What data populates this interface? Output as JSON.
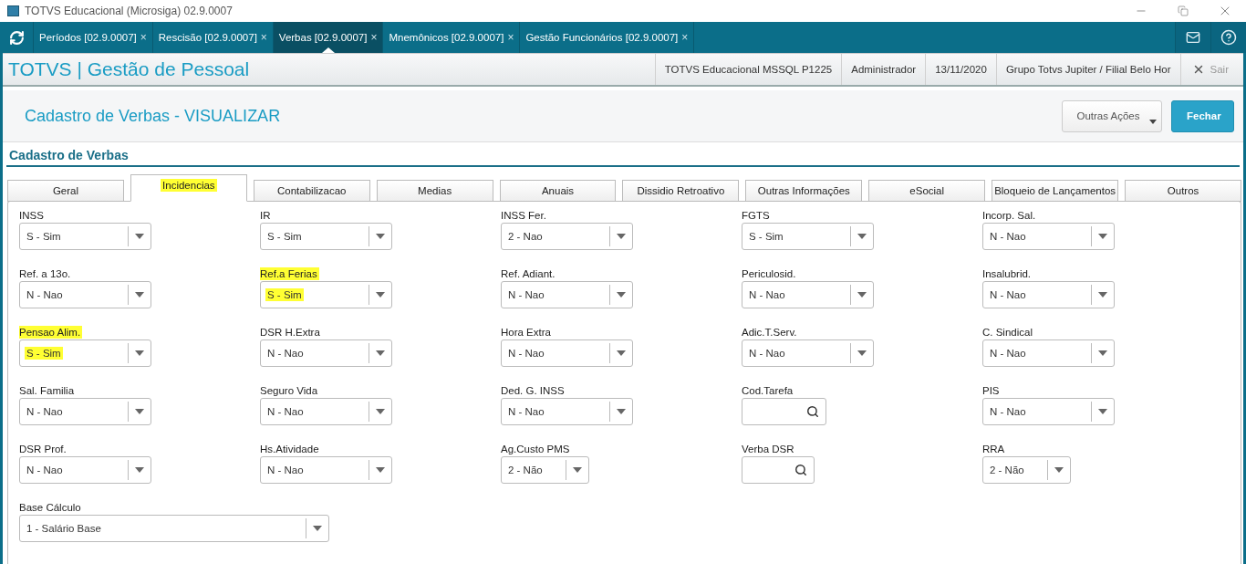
{
  "window": {
    "title": "TOTVS Educacional (Microsiga) 02.9.0007"
  },
  "app_tabs": [
    {
      "label": "Períodos [02.9.0007]",
      "close": "×",
      "selected": false
    },
    {
      "label": "Rescisão [02.9.0007]",
      "close": "×",
      "selected": false
    },
    {
      "label": "Verbas [02.9.0007]",
      "close": "×",
      "selected": true
    },
    {
      "label": "Mnemônicos [02.9.0007]",
      "close": "×",
      "selected": false
    },
    {
      "label": "Gestão Funcionários [02.9.0007]",
      "close": "×",
      "selected": false
    }
  ],
  "header": {
    "brand": "TOTVS | Gestão de Pessoal",
    "info": [
      "TOTVS Educacional MSSQL P1225",
      "Administrador",
      "13/11/2020",
      "Grupo Totvs Jupiter / Filial Belo Hor"
    ],
    "exit": "Sair"
  },
  "page": {
    "title": "Cadastro de Verbas - VISUALIZAR",
    "actions": [
      {
        "label": "Outras Ações",
        "kind": "menu"
      },
      {
        "label": "Fechar",
        "kind": "primary"
      }
    ]
  },
  "section": {
    "title": "Cadastro de Verbas"
  },
  "tabs": [
    {
      "label": "Geral",
      "selected": false,
      "highlighted": false
    },
    {
      "label": "Incidencias",
      "selected": true,
      "highlighted": true
    },
    {
      "label": "Contabilizacao",
      "selected": false,
      "highlighted": false
    },
    {
      "label": "Medias",
      "selected": false,
      "highlighted": false
    },
    {
      "label": "Anuais",
      "selected": false,
      "highlighted": false
    },
    {
      "label": "Dissidio Retroativo",
      "selected": false,
      "highlighted": false
    },
    {
      "label": "Outras Informações",
      "selected": false,
      "highlighted": false
    },
    {
      "label": "eSocial",
      "selected": false,
      "highlighted": false
    },
    {
      "label": "Bloqueio de Lançamentos",
      "selected": false,
      "highlighted": false
    },
    {
      "label": "Outros",
      "selected": false,
      "highlighted": false
    }
  ],
  "fields": [
    {
      "label": "INSS",
      "value": "S - Sim",
      "kind": "select",
      "highlighted": false
    },
    {
      "label": "IR",
      "value": "S - Sim",
      "kind": "select",
      "highlighted": false
    },
    {
      "label": "INSS Fer.",
      "value": "2 - Nao",
      "kind": "select",
      "highlighted": false
    },
    {
      "label": "FGTS",
      "value": "S - Sim",
      "kind": "select",
      "highlighted": false
    },
    {
      "label": "Incorp. Sal.",
      "value": "N - Nao",
      "kind": "select",
      "highlighted": false
    },
    {
      "label": "Ref. a 13o.",
      "value": "N - Nao",
      "kind": "select",
      "highlighted": false
    },
    {
      "label": "Ref.a Ferias",
      "value": "S - Sim",
      "kind": "select",
      "highlighted": true
    },
    {
      "label": "Ref. Adiant.",
      "value": "N - Nao",
      "kind": "select",
      "highlighted": false
    },
    {
      "label": "Periculosid.",
      "value": "N - Nao",
      "kind": "select",
      "highlighted": false
    },
    {
      "label": "Insalubrid.",
      "value": "N - Nao",
      "kind": "select",
      "highlighted": false
    },
    {
      "label": "Pensao Alim.",
      "value": "S - Sim",
      "kind": "select",
      "highlighted": true
    },
    {
      "label": "DSR H.Extra",
      "value": "N - Nao",
      "kind": "select",
      "highlighted": false
    },
    {
      "label": "Hora Extra",
      "value": "N - Nao",
      "kind": "select",
      "highlighted": false
    },
    {
      "label": "Adic.T.Serv.",
      "value": "N - Nao",
      "kind": "select",
      "highlighted": false
    },
    {
      "label": "C. Sindical",
      "value": "N - Nao",
      "kind": "select",
      "highlighted": false
    },
    {
      "label": "Sal. Familia",
      "value": "N - Nao",
      "kind": "select",
      "highlighted": false
    },
    {
      "label": "Seguro Vida",
      "value": "N - Nao",
      "kind": "select",
      "highlighted": false
    },
    {
      "label": "Ded. G. INSS",
      "value": "N - Nao",
      "kind": "select",
      "highlighted": false
    },
    {
      "label": "Cod.Tarefa",
      "kind": "search",
      "highlighted": false
    },
    {
      "label": "PIS",
      "value": "N - Nao",
      "kind": "select",
      "highlighted": false
    },
    {
      "label": "DSR Prof.",
      "value": "N - Nao",
      "kind": "select",
      "highlighted": false
    },
    {
      "label": "Hs.Atividade",
      "value": "N - Nao",
      "kind": "select",
      "highlighted": false
    },
    {
      "label": "Ag.Custo PMS",
      "value": "2 - Não",
      "kind": "select_small",
      "highlighted": false
    },
    {
      "label": "Verba DSR",
      "kind": "search_small",
      "highlighted": false
    },
    {
      "label": "RRA",
      "value": "2 - Não",
      "kind": "select_small",
      "highlighted": false
    },
    {
      "label": "Base Cálculo",
      "value": "1 - Salário Base",
      "kind": "select_wide",
      "highlighted": false
    }
  ]
}
